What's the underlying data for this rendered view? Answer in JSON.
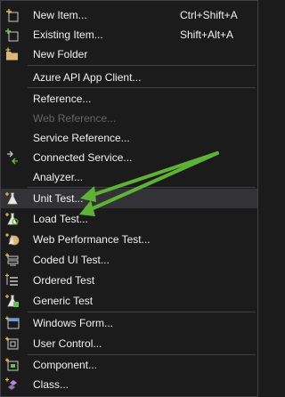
{
  "menu": {
    "items": [
      {
        "label": "New Item...",
        "shortcut": "Ctrl+Shift+A",
        "icon": "new-item-icon"
      },
      {
        "label": "Existing Item...",
        "shortcut": "Shift+Alt+A",
        "icon": "existing-item-icon"
      },
      {
        "label": "New Folder",
        "icon": "new-folder-icon"
      },
      {
        "label": "Azure API App Client..."
      },
      {
        "label": "Reference..."
      },
      {
        "label": "Web Reference...",
        "disabled": true
      },
      {
        "label": "Service Reference..."
      },
      {
        "label": "Connected Service...",
        "icon": "connected-service-icon"
      },
      {
        "label": "Analyzer..."
      },
      {
        "label": "Unit Test...",
        "icon": "unit-test-icon"
      },
      {
        "label": "Load Test...",
        "icon": "load-test-icon"
      },
      {
        "label": "Web Performance Test...",
        "icon": "web-performance-test-icon"
      },
      {
        "label": "Coded UI Test...",
        "icon": "coded-ui-test-icon"
      },
      {
        "label": "Ordered Test",
        "icon": "ordered-test-icon"
      },
      {
        "label": "Generic Test",
        "icon": "generic-test-icon"
      },
      {
        "label": "Windows Form...",
        "icon": "windows-form-icon"
      },
      {
        "label": "User Control...",
        "icon": "user-control-icon"
      },
      {
        "label": "Component...",
        "icon": "component-icon"
      },
      {
        "label": "Class...",
        "icon": "class-icon"
      }
    ]
  },
  "colors": {
    "background": "#1b1b1c",
    "hover": "#333337",
    "separator": "#3f3f46",
    "text": "#f1f1f1",
    "disabled_text": "#656565",
    "annotation_arrow": "#5fb236"
  }
}
